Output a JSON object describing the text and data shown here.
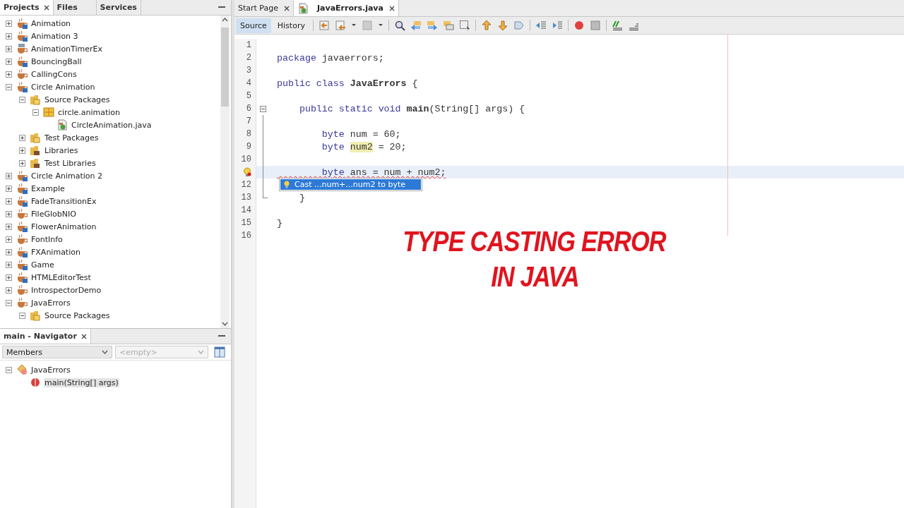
{
  "projects_panel": {
    "tabs": [
      {
        "label": "Projects",
        "selected": true
      },
      {
        "label": "Files",
        "selected": false
      },
      {
        "label": "Services",
        "selected": false
      }
    ],
    "tree": [
      {
        "label": "Animation",
        "kind": "fx",
        "expanded": false
      },
      {
        "label": "Animation 3",
        "kind": "fx",
        "expanded": false
      },
      {
        "label": "AnimationTimerEx",
        "kind": "timer",
        "expanded": false
      },
      {
        "label": "BouncingBall",
        "kind": "fx",
        "expanded": false
      },
      {
        "label": "CallingCons",
        "kind": "java",
        "expanded": false
      },
      {
        "label": "Circle Animation",
        "kind": "fx",
        "expanded": true,
        "children": [
          {
            "label": "Source Packages",
            "kind": "folder",
            "expanded": true,
            "children": [
              {
                "label": "circle.animation",
                "kind": "package",
                "expanded": true,
                "children": [
                  {
                    "label": "CircleAnimation.java",
                    "kind": "file"
                  }
                ]
              }
            ]
          },
          {
            "label": "Test Packages",
            "kind": "folder",
            "expanded": false
          },
          {
            "label": "Libraries",
            "kind": "library",
            "expanded": false
          },
          {
            "label": "Test Libraries",
            "kind": "library",
            "expanded": false
          }
        ]
      },
      {
        "label": "Circle Animation 2",
        "kind": "fx",
        "expanded": false
      },
      {
        "label": "Example",
        "kind": "fx",
        "expanded": false
      },
      {
        "label": "FadeTransitionEx",
        "kind": "fx",
        "expanded": false
      },
      {
        "label": "FileGlobNIO",
        "kind": "java",
        "expanded": false
      },
      {
        "label": "FlowerAnimation",
        "kind": "fx",
        "expanded": false
      },
      {
        "label": "FontInfo",
        "kind": "java",
        "expanded": false
      },
      {
        "label": "FXAnimation",
        "kind": "fx",
        "expanded": false
      },
      {
        "label": "Game",
        "kind": "fx",
        "expanded": false
      },
      {
        "label": "HTMLEditorTest",
        "kind": "fx",
        "expanded": false
      },
      {
        "label": "IntrospectorDemo",
        "kind": "java",
        "expanded": false
      },
      {
        "label": "JavaErrors",
        "kind": "java",
        "expanded": true,
        "children": [
          {
            "label": "Source Packages",
            "kind": "folder",
            "expanded": true
          }
        ]
      }
    ]
  },
  "navigator": {
    "title": "main - Navigator",
    "filter": "Members",
    "scope": {
      "placeholder": "<empty>"
    },
    "tree": [
      {
        "label": "JavaErrors",
        "kind": "class",
        "expanded": true,
        "children": [
          {
            "label": "main(String[] args)",
            "kind": "method",
            "selected": true
          }
        ]
      }
    ]
  },
  "editor": {
    "tabs": [
      {
        "label": "Start Page",
        "selected": false
      },
      {
        "label": "JavaErrors.java",
        "selected": true,
        "kind": "file"
      }
    ],
    "views": [
      {
        "label": "Source",
        "selected": true
      },
      {
        "label": "History",
        "selected": false
      }
    ],
    "lines": [
      {
        "number": "1"
      },
      {
        "number": "2",
        "segments": [
          {
            "kind": "kw",
            "text": "package"
          },
          {
            "kind": "plain",
            "text": " javaerrors;"
          }
        ]
      },
      {
        "number": "3"
      },
      {
        "number": "4",
        "segments": [
          {
            "kind": "kw",
            "text": "public class "
          },
          {
            "kind": "bold",
            "text": "JavaErrors"
          },
          {
            "kind": "plain",
            "text": " {"
          }
        ]
      },
      {
        "number": "5"
      },
      {
        "number": "6",
        "kind": "foldstart",
        "segments": [
          {
            "kind": "kw",
            "text": "    public static void "
          },
          {
            "kind": "bold",
            "text": "main"
          },
          {
            "kind": "plain",
            "text": "(String[] args) {"
          }
        ]
      },
      {
        "number": "7"
      },
      {
        "number": "8",
        "segments": [
          {
            "kind": "kw",
            "text": "        byte"
          },
          {
            "kind": "plain",
            "text": " num = 60;"
          }
        ]
      },
      {
        "number": "9",
        "segments": [
          {
            "kind": "kw",
            "text": "        byte "
          },
          {
            "kind": "mark",
            "text": "num2"
          },
          {
            "kind": "plain",
            "text": " = 20;"
          }
        ]
      },
      {
        "number": "10"
      },
      {
        "kind": "hint",
        "current": true,
        "error": true,
        "segments": [
          {
            "kind": "kw",
            "text": "        byte"
          },
          {
            "kind": "plain",
            "text": " ans = num + num2;"
          }
        ]
      },
      {
        "number": "12"
      },
      {
        "number": "13",
        "kind": "foldend",
        "segments": [
          {
            "kind": "plain",
            "text": "    }"
          }
        ]
      },
      {
        "number": "14"
      },
      {
        "number": "15",
        "segments": [
          {
            "kind": "plain",
            "text": "}"
          }
        ]
      },
      {
        "number": "16"
      }
    ],
    "suggestions": [
      {
        "label": "Cast ...num+...num2 to byte",
        "selected": true
      }
    ]
  },
  "overlay": {
    "lines": [
      "TYPE CASTING ERROR",
      "IN JAVA"
    ]
  }
}
